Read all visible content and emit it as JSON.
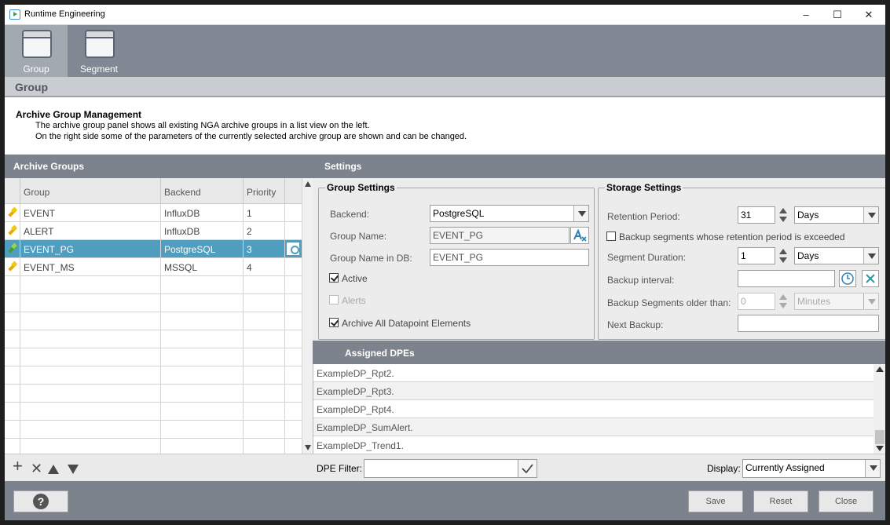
{
  "window": {
    "title": "Runtime Engineering",
    "minimize": "–",
    "maximize": "☐",
    "close": "✕"
  },
  "toolbar": {
    "items": [
      {
        "label": "Group"
      },
      {
        "label": "Segment"
      }
    ]
  },
  "section": {
    "title": "Group"
  },
  "description": {
    "heading": "Archive Group Management",
    "line1": "The archive group panel shows all existing NGA archive groups in a list view on the left.",
    "line2": "On the right side some of the parameters of the currently selected archive group are shown and can be changed."
  },
  "archive_groups": {
    "title": "Archive Groups",
    "columns": {
      "group": "Group",
      "backend": "Backend",
      "priority": "Priority"
    },
    "rows": [
      {
        "group": "EVENT",
        "backend": "InfluxDB",
        "priority": "1"
      },
      {
        "group": "ALERT",
        "backend": "InfluxDB",
        "priority": "2"
      },
      {
        "group": "EVENT_PG",
        "backend": "PostgreSQL",
        "priority": "3"
      },
      {
        "group": "EVENT_MS",
        "backend": "MSSQL",
        "priority": "4"
      }
    ]
  },
  "settings": {
    "title": "Settings",
    "group_settings": {
      "legend": "Group Settings",
      "backend_label": "Backend:",
      "backend_value": "PostgreSQL",
      "group_name_label": "Group Name:",
      "group_name_value": "EVENT_PG",
      "group_name_db_label": "Group Name in DB:",
      "group_name_db_value": "EVENT_PG",
      "active_label": "Active",
      "alerts_label": "Alerts",
      "archive_all_label": "Archive All Datapoint Elements"
    },
    "storage_settings": {
      "legend": "Storage Settings",
      "retention_label": "Retention Period:",
      "retention_value": "31",
      "retention_unit": "Days",
      "backup_exceeded_label": "Backup segments whose retention period is exceeded",
      "segment_duration_label": "Segment Duration:",
      "segment_duration_value": "1",
      "segment_duration_unit": "Days",
      "backup_interval_label": "Backup interval:",
      "backup_interval_value": "",
      "backup_older_label": "Backup Segments older than:",
      "backup_older_value": "0",
      "backup_older_unit": "Minutes",
      "next_backup_label": "Next Backup:",
      "next_backup_value": ""
    }
  },
  "assigned_dpes": {
    "title": "Assigned DPEs",
    "items": [
      "ExampleDP_Rpt2.",
      "ExampleDP_Rpt3.",
      "ExampleDP_Rpt4.",
      "ExampleDP_SumAlert.",
      "ExampleDP_Trend1."
    ]
  },
  "bottombar": {
    "add": "+",
    "remove": "✕",
    "dpe_filter_label": "DPE Filter:",
    "dpe_filter_value": "",
    "display_label": "Display:",
    "display_value": "Currently Assigned"
  },
  "footer": {
    "help": "?",
    "save": "Save",
    "reset": "Reset",
    "close": "Close"
  }
}
